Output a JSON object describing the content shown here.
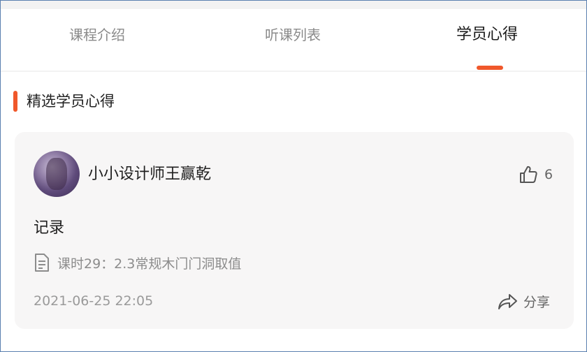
{
  "tabs": [
    {
      "label": "课程介绍",
      "active": false
    },
    {
      "label": "听课列表",
      "active": false
    },
    {
      "label": "学员心得",
      "active": true
    }
  ],
  "colors": {
    "accent": "#f0582b",
    "card_bg": "#f7f6f6",
    "text_primary": "#1f1f1f",
    "text_muted": "#9a9a9a"
  },
  "section": {
    "title": "精选学员心得"
  },
  "post": {
    "author": "小小设计师王赢乾",
    "likes": "6",
    "content": "记录",
    "lesson": "课时29：2.3常规木门门洞取值",
    "timestamp": "2021-06-25 22:05",
    "share_label": "分享",
    "icons": {
      "like": "thumbs-up-icon",
      "lesson": "document-icon",
      "share": "share-icon"
    }
  }
}
